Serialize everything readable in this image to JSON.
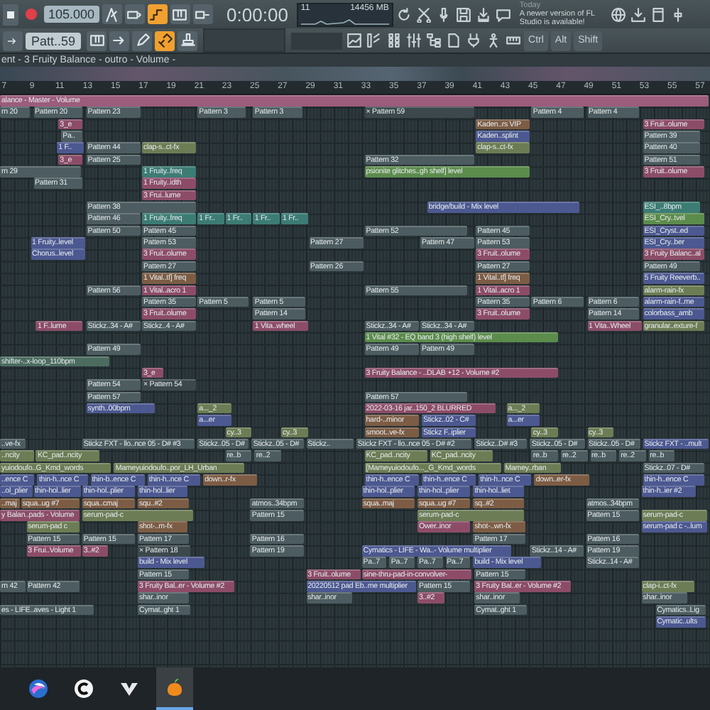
{
  "toolbar": {
    "tempo": "105.000",
    "time": "0:00:00",
    "cpu": "11",
    "memory": "14456 MB",
    "pattern": "Patt..59",
    "news_day": "Today",
    "news": "A newer version of FL Studio is available!",
    "row1": [
      {
        "kind": "metronome",
        "on": false
      },
      {
        "kind": "loop",
        "on": false
      },
      {
        "kind": "step",
        "on": true
      },
      {
        "kind": "piano",
        "on": false
      },
      {
        "kind": "wait",
        "on": false
      }
    ],
    "row1_right": [
      {
        "kind": "refresh"
      },
      {
        "kind": "scissors"
      },
      {
        "kind": "microphone"
      },
      {
        "kind": "save"
      },
      {
        "kind": "export"
      },
      {
        "kind": "speech"
      }
    ],
    "row1_far": [
      {
        "kind": "globe"
      },
      {
        "kind": "download"
      },
      {
        "kind": "window"
      },
      {
        "kind": "slider"
      }
    ],
    "row2": [
      {
        "kind": "piano",
        "on": false
      },
      {
        "kind": "arrow",
        "on": false
      },
      {
        "kind": "pencil",
        "on": false
      },
      {
        "kind": "link",
        "on": true
      },
      {
        "kind": "stamp",
        "on": false
      }
    ],
    "row2_right": [
      {
        "kind": "chart"
      },
      {
        "kind": "steps"
      },
      {
        "kind": "grid"
      },
      {
        "kind": "mixer"
      },
      {
        "kind": "tree"
      },
      {
        "kind": "document"
      },
      {
        "kind": "plug"
      },
      {
        "kind": "person"
      },
      {
        "kind": "keyboard"
      }
    ],
    "keys": [
      "Ctrl",
      "Alt",
      "Shift"
    ]
  },
  "breadcrumb": "ent - 3 Fruity Balance - outro - Volume -",
  "ruler": [
    "7",
    "9",
    "11",
    "13",
    "15",
    "17",
    "19",
    "21",
    "23",
    "25",
    "27",
    "29",
    "31",
    "33",
    "35",
    "37",
    "39",
    "41",
    "43",
    "45",
    "47",
    "49",
    "51",
    "53",
    "55",
    "57"
  ],
  "tracks": [
    [
      {
        "label": "alance - Master - Volume",
        "color": "#9c5c7c"
      }
    ],
    [
      {
        "label": "rn 20",
        "color": "#4c5c60"
      },
      {
        "label": "Pattern 20",
        "color": "#4c5c60"
      },
      {
        "label": "Pattern 23",
        "color": "#4c5c60"
      },
      {
        "label": "Pattern 3",
        "color": "#4c5c60"
      },
      {
        "label": "Pattern 3",
        "color": "#4c5c60"
      },
      {
        "label": "× Pattern 59",
        "color": "#3c484c"
      },
      {
        "label": "Pattern 4",
        "color": "#4c5c60"
      },
      {
        "label": "Pattern 4",
        "color": "#4c5c60"
      }
    ],
    [
      {
        "label": "3_e",
        "color": "#8c4c68"
      },
      {
        "label": "Kaden..rs VIP",
        "color": "#7c5c44"
      },
      {
        "label": "3 Fruit..olume",
        "color": "#8c4c68"
      }
    ],
    [
      {
        "label": "Pa..",
        "color": "#4c5c60"
      },
      {
        "label": "Kaden..splint",
        "color": "#4c5890"
      },
      {
        "label": "Pattern 39",
        "color": "#4c5c60"
      }
    ],
    [
      {
        "label": "1 F..",
        "color": "#4c5890"
      },
      {
        "label": "Pattern 44",
        "color": "#4c5c60"
      },
      {
        "label": "clap-s..ct-fx",
        "color": "#6c7c54"
      },
      {
        "label": "clap-s..ct-fx",
        "color": "#6c7c54"
      },
      {
        "label": "Pattern 40",
        "color": "#4c5c60"
      }
    ],
    [
      {
        "label": "3_e",
        "color": "#8c4c68"
      },
      {
        "label": "Pattern 25",
        "color": "#4c5c60"
      },
      {
        "label": "Pattern 32",
        "color": "#4c5c60"
      },
      {
        "label": "Pattern 51",
        "color": "#4c5c60"
      }
    ],
    [
      {
        "label": "rn 29",
        "color": "#4c5c60"
      },
      {
        "label": "1 Fruity..freq",
        "color": "#3c7c74"
      },
      {
        "label": "psionite glitches..gh shelf] level",
        "color": "#5c8c4c"
      },
      {
        "label": "3 Fruit..olume",
        "color": "#8c4c68"
      }
    ],
    [
      {
        "label": "Pattern 31",
        "color": "#4c5c60"
      },
      {
        "label": "1 Fruity..idth",
        "color": "#8c4c68"
      }
    ],
    [
      {
        "label": "3 Frui..lume",
        "color": "#8c4c68"
      }
    ],
    [
      {
        "label": "Pattern 38",
        "color": "#4c5c60"
      },
      {
        "label": "bridge/build - Mix level",
        "color": "#4c5890"
      },
      {
        "label": "ESI_..8bpm",
        "color": "#3c7c74"
      }
    ],
    [
      {
        "label": "Pattern 46",
        "color": "#4c5c60"
      },
      {
        "label": "1 Fruity..freq",
        "color": "#3c7c74"
      },
      {
        "label": "1 Fr..",
        "color": "#3c7c74"
      },
      {
        "label": "1 Fr..",
        "color": "#3c7c74"
      },
      {
        "label": "1 Fr..",
        "color": "#3c7c74"
      },
      {
        "label": "1 Fr..",
        "color": "#3c7c74"
      },
      {
        "label": "ESI_Cry..tvel",
        "color": "#5c8c4c"
      }
    ],
    [
      {
        "label": "Pattern 50",
        "color": "#4c5c60"
      },
      {
        "label": "Pattern 45",
        "color": "#4c5c60"
      },
      {
        "label": "Pattern 52",
        "color": "#4c5c60"
      },
      {
        "label": "Pattern 45",
        "color": "#4c5c60"
      },
      {
        "label": "ESI_Cryst..ed",
        "color": "#4c5890"
      }
    ],
    [
      {
        "label": "1 Fruity..level",
        "color": "#4c5890"
      },
      {
        "label": "Pattern 53",
        "color": "#4c5c60"
      },
      {
        "label": "Pattern 27",
        "color": "#4c5c60"
      },
      {
        "label": "Pattern 47",
        "color": "#4c5c60"
      },
      {
        "label": "Pattern 53",
        "color": "#4c5c60"
      },
      {
        "label": "ESI_Cry..ber",
        "color": "#4c5890"
      }
    ],
    [
      {
        "label": "Chorus..level",
        "color": "#4c5890"
      },
      {
        "label": "3 Fruit..olume",
        "color": "#8c4c68"
      },
      {
        "label": "3 Fruit..olume",
        "color": "#8c4c68"
      },
      {
        "label": "3 Fruity Balanc..al",
        "color": "#8c4c68"
      }
    ],
    [
      {
        "label": "Pattern 27",
        "color": "#4c5c60"
      },
      {
        "label": "Pattern 26",
        "color": "#4c5c60"
      },
      {
        "label": "Pattern 27",
        "color": "#4c5c60"
      },
      {
        "label": "Pattern 49",
        "color": "#4c5c60"
      }
    ],
    [
      {
        "label": "1 Vital..tf] freq",
        "color": "#7c5c44"
      },
      {
        "label": "1 Vital..tf] freq",
        "color": "#7c5c44"
      },
      {
        "label": "5 Fruity Reeverb..",
        "color": "#4c5890"
      }
    ],
    [
      {
        "label": "Pattern 56",
        "color": "#4c5c60"
      },
      {
        "label": "1 Vital..acro 1",
        "color": "#8c4c68"
      },
      {
        "label": "Pattern 55",
        "color": "#4c5c60"
      },
      {
        "label": "1 Vital..acro 1",
        "color": "#8c4c68"
      },
      {
        "label": "alarm-rain-fx",
        "color": "#6c7c54"
      }
    ],
    [
      {
        "label": "Pattern 35",
        "color": "#4c5c60"
      },
      {
        "label": "Pattern 5",
        "color": "#4c5c60"
      },
      {
        "label": "Pattern 5",
        "color": "#4c5c60"
      },
      {
        "label": "Pattern 35",
        "color": "#4c5c60"
      },
      {
        "label": "Pattern 6",
        "color": "#4c5c60"
      },
      {
        "label": "Pattern 6",
        "color": "#4c5c60"
      },
      {
        "label": "alarm-rain-f..me",
        "color": "#4c5890"
      }
    ],
    [
      {
        "label": "3 Fruit..olume",
        "color": "#8c4c68"
      },
      {
        "label": "Pattern 14",
        "color": "#4c5c60"
      },
      {
        "label": "3 Fruit..olume",
        "color": "#8c4c68"
      },
      {
        "label": "Pattern 14",
        "color": "#4c5c60"
      },
      {
        "label": "colorbass_amb",
        "color": "#4c5890"
      }
    ],
    [
      {
        "label": "1 F..lume",
        "color": "#8c4c68"
      },
      {
        "label": "Stickz..34 - A#",
        "color": "#4c5c60"
      },
      {
        "label": "Stickz..4 - A#",
        "color": "#4c5c60"
      },
      {
        "label": "1 Vita..wheel",
        "color": "#8c4c68"
      },
      {
        "label": "Stickz..34 - A#",
        "color": "#4c5c60"
      },
      {
        "label": "Stickz..34 - A#",
        "color": "#4c5c60"
      },
      {
        "label": "1 Vita..Wheel",
        "color": "#8c4c68"
      },
      {
        "label": "granular..exture-f",
        "color": "#6c7c54"
      }
    ],
    [
      {
        "label": "1 Vital #32 - EQ band 3 (high shelf) level",
        "color": "#5c8c4c"
      }
    ],
    [
      {
        "label": "Pattern 49",
        "color": "#4c5c60"
      },
      {
        "label": "Pattern 49",
        "color": "#4c5c60"
      },
      {
        "label": "Pattern 49",
        "color": "#4c5c60"
      }
    ],
    [
      {
        "label": "shifter-..x-loop_110bpm",
        "color": "#4c6c60"
      }
    ],
    [
      {
        "label": "3_e",
        "color": "#8c4c68"
      },
      {
        "label": "3 Fruity Balance - ..DLAB +12 - Volume #2",
        "color": "#8c4c68"
      }
    ],
    [
      {
        "label": "Pattern 54",
        "color": "#4c5c60"
      },
      {
        "label": "× Pattern 54",
        "color": "#3c484c"
      }
    ],
    [
      {
        "label": "Pattern 57",
        "color": "#4c5c60"
      },
      {
        "label": "Pattern 57",
        "color": "#4c5c60"
      }
    ],
    [
      {
        "label": "synth..00bpm",
        "color": "#4c5890"
      },
      {
        "label": "a..._2",
        "color": "#6c7c54"
      },
      {
        "label": "2022-03-16 jar..150_2 BLURRED",
        "color": "#8c4c68"
      },
      {
        "label": "a..._2",
        "color": "#6c7c54"
      }
    ],
    [
      {
        "label": "a...er",
        "color": "#4c5890"
      },
      {
        "label": "hard-..minor",
        "color": "#7c5c44"
      },
      {
        "label": "Stickz..02 - C#",
        "color": "#4c5890"
      },
      {
        "label": "a...er",
        "color": "#4c5890"
      }
    ],
    [
      {
        "label": "cy..3",
        "color": "#6c7c54"
      },
      {
        "label": "cy..3",
        "color": "#6c7c54"
      },
      {
        "label": "smoot..ve-fx",
        "color": "#7c5c44"
      },
      {
        "label": "Stickz F..iplier",
        "color": "#4c5890"
      },
      {
        "label": "cy..3",
        "color": "#6c7c54"
      },
      {
        "label": "cy..3",
        "color": "#6c7c54"
      }
    ],
    [
      {
        "label": "..ve-fx",
        "color": "#4c5c60"
      },
      {
        "label": "Stickz FXT - llo..nce 05 - D# #3",
        "color": "#4c5c60"
      },
      {
        "label": "Stickz..05 - D#",
        "color": "#4c5c60"
      },
      {
        "label": "Stickz..05 - D#",
        "color": "#4c5c60"
      },
      {
        "label": "Stickz..",
        "color": "#4c5c60"
      },
      {
        "label": "Stickz FXT - llo..nce 05 - D# #2",
        "color": "#4c5c60"
      },
      {
        "label": "Stickz..D# #3",
        "color": "#4c5c60"
      },
      {
        "label": "Stickz..05 - D#",
        "color": "#4c5c60"
      },
      {
        "label": "Stickz..05 - D#",
        "color": "#4c5c60"
      },
      {
        "label": "Stickz FXT - ..mult",
        "color": "#4c5890"
      }
    ],
    [
      {
        "label": "..ncity",
        "color": "#6c7c54"
      },
      {
        "label": "KC_pad..ncity",
        "color": "#6c7c54"
      },
      {
        "label": "re..b",
        "color": "#4c5c60"
      },
      {
        "label": "re..2",
        "color": "#4c5c60"
      },
      {
        "label": "KC_pad..ncity",
        "color": "#6c7c54"
      },
      {
        "label": "KC_pad..ncity",
        "color": "#6c7c54"
      },
      {
        "label": "re..b",
        "color": "#4c5c60"
      },
      {
        "label": "re..2",
        "color": "#4c5c60"
      },
      {
        "label": "re..b",
        "color": "#4c5c60"
      },
      {
        "label": "re..2",
        "color": "#4c5c60"
      },
      {
        "label": "re..b",
        "color": "#4c5c60"
      }
    ],
    [
      {
        "label": "yuiodoufo..G_Kmd_words",
        "color": "#6c7c54"
      },
      {
        "label": "Mameyuiodoufo..por_LH_Urban",
        "color": "#6c7c54"
      },
      {
        "label": "[Mameyuiodoufo..._G_Kmd_words",
        "color": "#6c7c54"
      },
      {
        "label": "Mamey..rban",
        "color": "#6c7c54"
      },
      {
        "label": "Stickz..07 - D#",
        "color": "#4c5c60"
      }
    ],
    [
      {
        "label": "..ence C",
        "color": "#4c5890"
      },
      {
        "label": "thin-h..nce C",
        "color": "#4c5890"
      },
      {
        "label": "thin-b..ence C",
        "color": "#4c5890"
      },
      {
        "label": "thin-h..nce C",
        "color": "#4c5890"
      },
      {
        "label": "down..r-fx",
        "color": "#7c5c44"
      },
      {
        "label": "thin-h..ence C",
        "color": "#4c5890"
      },
      {
        "label": "thin-h..ence C",
        "color": "#4c5890"
      },
      {
        "label": "thin-h..nce C",
        "color": "#4c5890"
      },
      {
        "label": "down..er-fx",
        "color": "#7c5c44"
      },
      {
        "label": "thin-h..ence C",
        "color": "#4c5890"
      }
    ],
    [
      {
        "label": "..ol_plier",
        "color": "#4c5890"
      },
      {
        "label": "thin-hol..lier",
        "color": "#4c5890"
      },
      {
        "label": "thin-hol..plier",
        "color": "#4c5890"
      },
      {
        "label": "thin-hol..lier",
        "color": "#4c5890"
      },
      {
        "label": "thin-hol..plier",
        "color": "#4c5890"
      },
      {
        "label": "thin-hol..plier",
        "color": "#4c5890"
      },
      {
        "label": "thin-hol..liet",
        "color": "#4c5890"
      },
      {
        "label": "thin-h..ier #2",
        "color": "#4c5890"
      }
    ],
    [
      {
        "label": "..maj",
        "color": "#7c5c44"
      },
      {
        "label": "squa..ug #7",
        "color": "#7c5c44"
      },
      {
        "label": "squa..cmaj",
        "color": "#7c5c44"
      },
      {
        "label": "squ..#2",
        "color": "#7c5c44"
      },
      {
        "label": "atmos..34bpm",
        "color": "#4c5c60"
      },
      {
        "label": "squa..maj",
        "color": "#7c5c44"
      },
      {
        "label": "squa..ug #7",
        "color": "#7c5c44"
      },
      {
        "label": "sq..#2",
        "color": "#7c5c44"
      },
      {
        "label": "atmos..34bpm",
        "color": "#4c5c60"
      }
    ],
    [
      {
        "label": "y Balan..pads - Volume",
        "color": "#8c4c68"
      },
      {
        "label": "serum-pad-c",
        "color": "#6c7c54"
      },
      {
        "label": "Pattern 15",
        "color": "#4c5c60"
      },
      {
        "label": "serum-pad-c",
        "color": "#6c7c54"
      },
      {
        "label": "Pattern 15",
        "color": "#4c5c60"
      },
      {
        "label": "serum-pad-c",
        "color": "#6c7c54"
      }
    ],
    [
      {
        "label": "serum-pad c",
        "color": "#6c7c54"
      },
      {
        "label": "shot-..m-fx",
        "color": "#7c5c44"
      },
      {
        "label": "Ower..inor",
        "color": "#8c4c68"
      },
      {
        "label": "shot-..wn-fx",
        "color": "#7c5c44"
      },
      {
        "label": "serum-pad c -..lum",
        "color": "#4c5890"
      }
    ],
    [
      {
        "label": "Pattern 15",
        "color": "#4c5c60"
      },
      {
        "label": "Pattern 15",
        "color": "#4c5c60"
      },
      {
        "label": "Pattern 17",
        "color": "#4c5c60"
      },
      {
        "label": "Pattern 16",
        "color": "#4c5c60"
      },
      {
        "label": "Pattern 17",
        "color": "#4c5c60"
      },
      {
        "label": "Pattern 16",
        "color": "#4c5c60"
      }
    ],
    [
      {
        "label": "3 Frui..Volume",
        "color": "#8c4c68"
      },
      {
        "label": "3..#2",
        "color": "#8c4c68"
      },
      {
        "label": "× Pattern 18",
        "color": "#3c484c"
      },
      {
        "label": "Pattern 19",
        "color": "#4c5c60"
      },
      {
        "label": "Cymatics - LIFE - Wa..- Volume multiplier",
        "color": "#4c5890"
      },
      {
        "label": "Stickz..14 - A#",
        "color": "#4c5c60"
      },
      {
        "label": "Pattern 19",
        "color": "#4c5c60"
      }
    ],
    [
      {
        "label": "build - Mix level",
        "color": "#4c5890"
      },
      {
        "label": "Pa..7",
        "color": "#4c5c60"
      },
      {
        "label": "Pa..7",
        "color": "#4c5c60"
      },
      {
        "label": "Pa..7",
        "color": "#4c5c60"
      },
      {
        "label": "Pa..7",
        "color": "#4c5c60"
      },
      {
        "label": "build - Mix level",
        "color": "#4c5890"
      },
      {
        "label": "Stickz..14 - A#",
        "color": "#4c5c60"
      }
    ],
    [
      {
        "label": "Pattern 15",
        "color": "#4c5c60"
      },
      {
        "label": "3 Fruit..olume",
        "color": "#8c4c68"
      },
      {
        "label": "sine-thru-pad-in-convolver-",
        "color": "#8c4c68"
      },
      {
        "label": "Pattern 15",
        "color": "#4c5c60"
      }
    ],
    [
      {
        "label": "rn 42",
        "color": "#4c5c60"
      },
      {
        "label": "Pattern 42",
        "color": "#4c5c60"
      },
      {
        "label": "3 Fruity Bal..er - Volume #2",
        "color": "#8c4c68"
      },
      {
        "label": "20220512 pad Eb..me multiplier",
        "color": "#4c5890"
      },
      {
        "label": "Pattern 15",
        "color": "#4c5c60"
      },
      {
        "label": "3 Fruity Bal..er - Volume #2",
        "color": "#8c4c68"
      },
      {
        "label": "clap-i..ct-fx",
        "color": "#6c7c54"
      }
    ],
    [
      {
        "label": "shar..inor",
        "color": "#4c5c60"
      },
      {
        "label": "shar..inor",
        "color": "#4c5c60"
      },
      {
        "label": "3..#2",
        "color": "#8c4c68"
      },
      {
        "label": "shar..inor",
        "color": "#4c5c60"
      },
      {
        "label": "shar..inor",
        "color": "#4c5c60"
      }
    ],
    [
      {
        "label": "es - LIFE..aves - Light 1",
        "color": "#4c5c60"
      },
      {
        "label": "Cymat..ght 1",
        "color": "#4c5c60"
      },
      {
        "label": "Cymat..ght 1",
        "color": "#4c5c60"
      },
      {
        "label": "Cymatics..Lig",
        "color": "#4c5c60"
      }
    ],
    [
      {
        "label": "Cymatic..ults",
        "color": "#4c5890"
      }
    ]
  ],
  "taskbar": [
    {
      "kind": "swirl",
      "selected": false
    },
    {
      "kind": "ring",
      "selected": false
    },
    {
      "kind": "chevron",
      "selected": false
    },
    {
      "kind": "fruit",
      "selected": true
    }
  ]
}
